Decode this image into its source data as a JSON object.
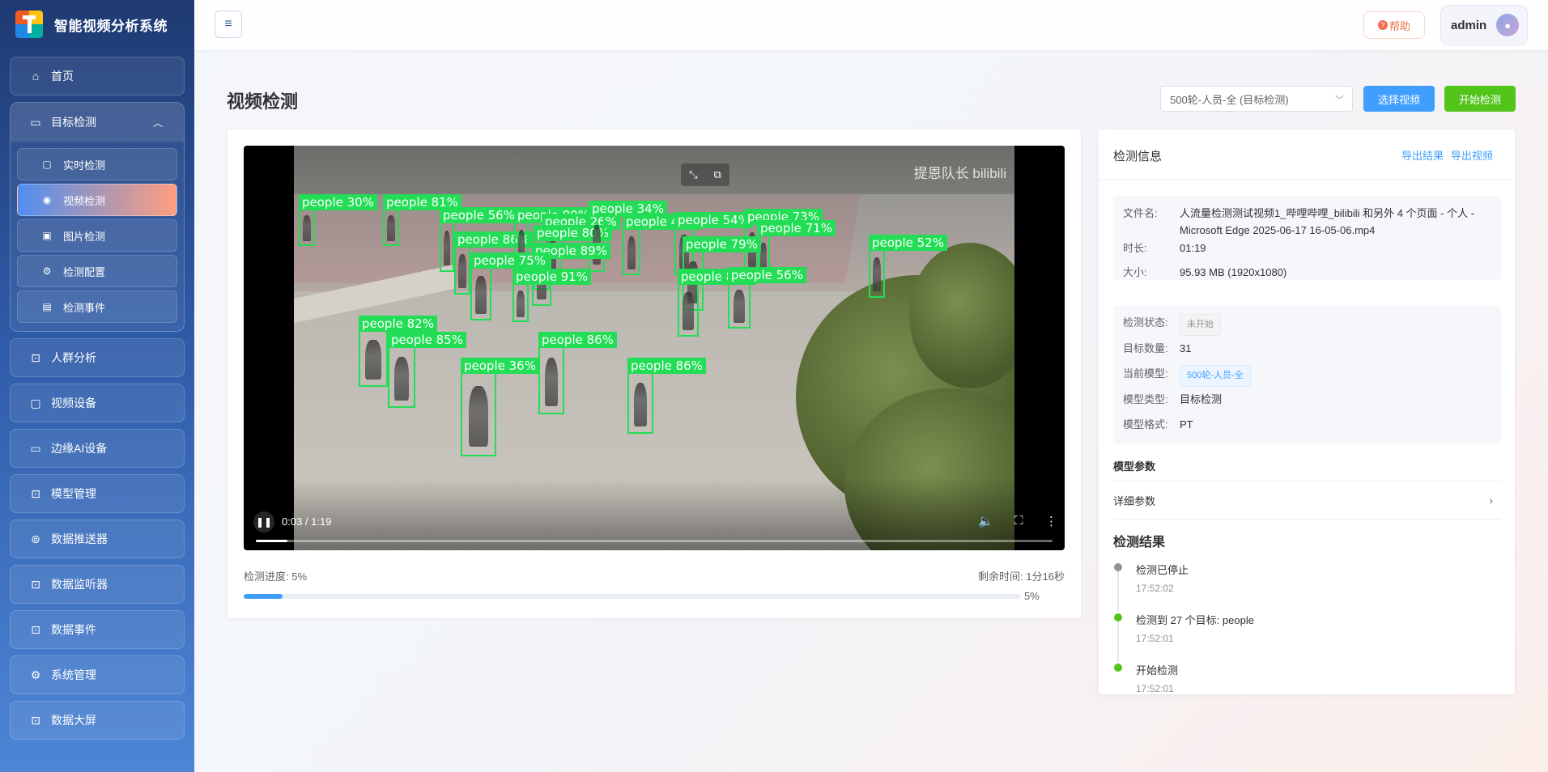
{
  "app": {
    "title": "智能视频分析系统"
  },
  "sidebar": {
    "home": {
      "label": "首页"
    },
    "target": {
      "label": "目标检测",
      "children": [
        "实时检测",
        "视频检测",
        "图片检测",
        "检测配置",
        "检测事件"
      ]
    },
    "items": [
      "人群分析",
      "视频设备",
      "边缘AI设备",
      "模型管理",
      "数据推送器",
      "数据监听器",
      "数据事件",
      "系统管理",
      "数据大屏"
    ]
  },
  "header": {
    "menu_icon": "≡",
    "help_label": "帮助",
    "user": "admin"
  },
  "page": {
    "title": "视频检测",
    "model_select": "500轮-人员-全 (目标检测)",
    "select_video_label": "选择视频",
    "start_label": "开始检测"
  },
  "video": {
    "watermark": "提恩队长 bilibili",
    "time": "0:03 / 1:19",
    "played_fraction": 0.04,
    "detections": [
      {
        "label": "people 30%"
      },
      {
        "label": "people 81%"
      },
      {
        "label": "people 56%"
      },
      {
        "label": "people 86%"
      },
      {
        "label": "people 80%"
      },
      {
        "label": "people 26%"
      },
      {
        "label": "people 80%"
      },
      {
        "label": "people 34%"
      },
      {
        "label": "people 44%"
      },
      {
        "label": "people 54%"
      },
      {
        "label": "people 73%"
      },
      {
        "label": "people 71%"
      },
      {
        "label": "people 89%"
      },
      {
        "label": "people 75%"
      },
      {
        "label": "people 91%"
      },
      {
        "label": "people 79%"
      },
      {
        "label": "people 82%"
      },
      {
        "label": "people 56%"
      },
      {
        "label": "people 52%"
      },
      {
        "label": "people 82%"
      },
      {
        "label": "people 85%"
      },
      {
        "label": "people 86%"
      },
      {
        "label": "people 36%"
      },
      {
        "label": "people 86%"
      }
    ]
  },
  "progress": {
    "label": "检测进度:",
    "value_text": "5%",
    "fraction": 0.05,
    "remain_label": "剩余时间:",
    "remain_value": "1分16秒",
    "pct_text": "5%"
  },
  "info": {
    "title": "检测信息",
    "export_result": "导出结果",
    "export_video": "导出视频",
    "file": {
      "name_label": "文件名:",
      "name": "人流量检测测试视频1_哔哩哔哩_bilibili 和另外 4 个页面 - 个人 - Microsoft Edge 2025-06-17 16-05-06.mp4",
      "duration_label": "时长:",
      "duration": "01:19",
      "size_label": "大小:",
      "size": "95.93 MB (1920x1080)"
    },
    "status": {
      "state_label": "检测状态:",
      "state": "未开始",
      "count_label": "目标数量:",
      "count": "31",
      "model_label": "当前模型:",
      "model": "500轮-人员-全",
      "type_label": "模型类型:",
      "type": "目标检测",
      "format_label": "模型格式:",
      "format": "PT"
    },
    "params_title": "模型参数",
    "params_row": "详细参数",
    "results_title": "检测结果",
    "timeline": [
      {
        "text": "检测已停止",
        "time": "17:52:02",
        "color": "#909399"
      },
      {
        "text": "检测到 27 个目标: people",
        "time": "17:52:01",
        "color": "#52c41a"
      },
      {
        "text": "开始检测",
        "time": "17:52:01",
        "color": "#52c41a"
      }
    ]
  }
}
